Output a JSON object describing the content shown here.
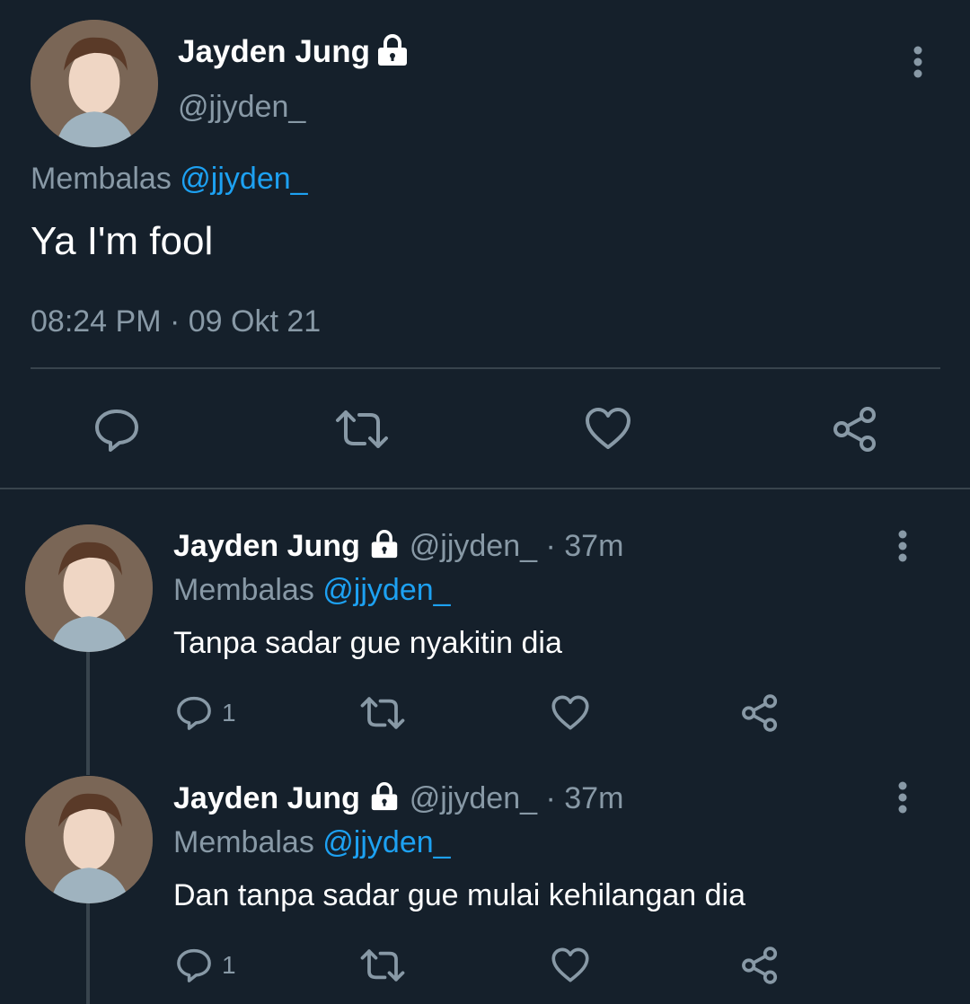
{
  "main_tweet": {
    "display_name": "Jayden Jung",
    "handle": "@jjyden_",
    "reply_prefix": "Membalas",
    "reply_to": "@jjyden_",
    "text": "Ya I'm fool",
    "time": "08:24 PM",
    "separator": "·",
    "date": "09 Okt 21"
  },
  "replies": [
    {
      "display_name": "Jayden Jung",
      "handle": "@jjyden_",
      "separator": "·",
      "age": "37m",
      "reply_prefix": "Membalas",
      "reply_to": "@jjyden_",
      "text": "Tanpa sadar gue nyakitin dia",
      "reply_count": "1"
    },
    {
      "display_name": "Jayden Jung",
      "handle": "@jjyden_",
      "separator": "·",
      "age": "37m",
      "reply_prefix": "Membalas",
      "reply_to": "@jjyden_",
      "text": "Dan tanpa sadar gue mulai kehilangan dia",
      "reply_count": "1"
    }
  ],
  "colors": {
    "background": "#15202b",
    "muted": "#8899a6",
    "link": "#1da1f2",
    "divider": "#38444d"
  },
  "icons": [
    "lock-icon",
    "more-icon",
    "reply-icon",
    "retweet-icon",
    "like-icon",
    "share-icon"
  ]
}
